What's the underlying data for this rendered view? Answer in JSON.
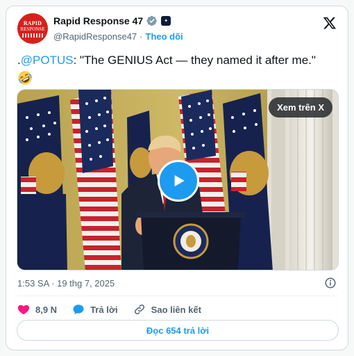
{
  "author": {
    "display_name": "Rapid Response 47",
    "handle": "@RapidResponse47",
    "separator": "·",
    "follow_label": "Theo dõi",
    "avatar_text_line1": "RAPID",
    "avatar_text_line2": "RESPONSE",
    "avatar_color": "#d8201b"
  },
  "tweet": {
    "prefix": ".",
    "mention": "@POTUS",
    "body": ": \"The GENIUS Act — they named it after me.\"",
    "emoji": "rolling-on-floor-laughing"
  },
  "media": {
    "watch_label": "Xem trên X",
    "play_icon": "play-icon"
  },
  "meta": {
    "timestamp": "1:53 SA · 19 thg 7, 2025"
  },
  "actions": {
    "like_count": "8,9 N",
    "reply_label": "Trả lời",
    "copy_link_label": "Sao liên kết"
  },
  "footer": {
    "read_replies_label": "Đọc 654 trả lời"
  },
  "colors": {
    "accent": "#1d9bf0",
    "like": "#f91880",
    "text": "#0f1419",
    "muted": "#536471"
  }
}
